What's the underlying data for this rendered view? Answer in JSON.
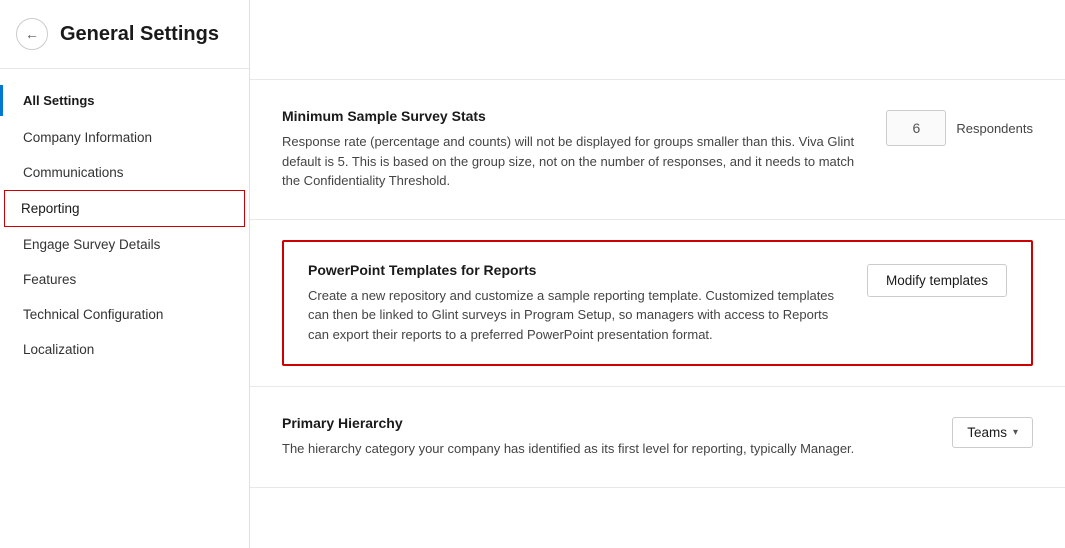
{
  "sidebar": {
    "title": "General Settings",
    "back_label": "←",
    "nav": {
      "all_settings_label": "All Settings",
      "items": [
        {
          "id": "company-information",
          "label": "Company Information",
          "active": false
        },
        {
          "id": "communications",
          "label": "Communications",
          "active": false
        },
        {
          "id": "reporting",
          "label": "Reporting",
          "active": true
        },
        {
          "id": "engage-survey-details",
          "label": "Engage Survey Details",
          "active": false
        },
        {
          "id": "features",
          "label": "Features",
          "active": false
        },
        {
          "id": "technical-configuration",
          "label": "Technical Configuration",
          "active": false
        },
        {
          "id": "localization",
          "label": "Localization",
          "active": false
        }
      ]
    }
  },
  "main": {
    "minimum_sample": {
      "title": "Minimum Sample Survey Stats",
      "description": "Response rate (percentage and counts) will not be displayed for groups smaller than this. Viva Glint default is 5. This is based on the group size, not on the number of responses, and it needs to match the Confidentiality Threshold.",
      "value": "6",
      "respondents_label": "Respondents"
    },
    "powerpoint": {
      "title": "PowerPoint Templates for Reports",
      "description": "Create a new repository and customize a sample reporting template. Customized templates can then be linked to Glint surveys in Program Setup, so managers with access to Reports can export their reports to a preferred PowerPoint presentation format.",
      "button_label": "Modify templates"
    },
    "primary_hierarchy": {
      "title": "Primary Hierarchy",
      "description": "The hierarchy category your company has identified as its first level for reporting, typically Manager.",
      "dropdown_label": "Teams",
      "dropdown_icon": "▾"
    }
  }
}
